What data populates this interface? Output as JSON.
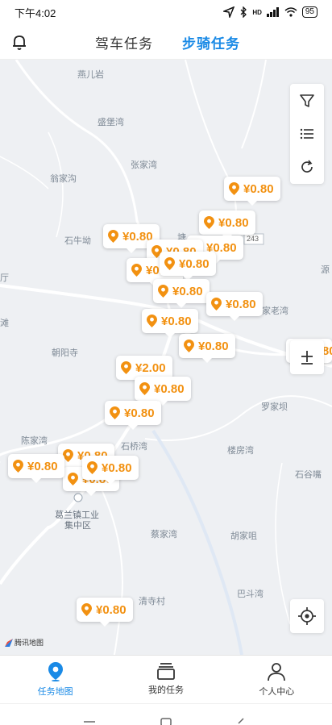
{
  "status_bar": {
    "time": "下午4:02",
    "signal": "HD",
    "battery": "95"
  },
  "header": {
    "tab_driving": "驾车任务",
    "tab_riding": "步骑任务"
  },
  "map": {
    "places": {
      "yaner_yan": "燕儿岩",
      "shengbao_wan": "盛堡湾",
      "zhangjia_wan": "张家湾",
      "wengjia_gou": "翁家沟",
      "shiniu_ao": "石牛坳",
      "zhaoyang_si": "朝阳寺",
      "ting": "厅",
      "tan": "滩",
      "yuan": "源",
      "tu": "塘",
      "jia_lao_wan": "家老湾",
      "luojia_ba": "罗家坝",
      "chenjia_wan": "陈家湾",
      "shiqiao_wan": "石桥湾",
      "loufang_wan": "楼房湾",
      "shigu_ping": "石谷嘴",
      "gelan_industrial": "葛兰镇工业",
      "jizhongqu": "集中区",
      "caijia_wan": "蔡家湾",
      "hujia_ao": "胡家咀",
      "badou_wan": "巴斗湾",
      "qingsi_cun": "清寺村",
      "road_number": "243"
    },
    "markers": [
      {
        "amount": "¥0.80"
      },
      {
        "amount": "¥0.80"
      },
      {
        "amount": "¥0.80"
      },
      {
        "amount": "¥0.80"
      },
      {
        "amount": "¥0.80"
      },
      {
        "amount": "¥0.80"
      },
      {
        "amount": "¥0.80"
      },
      {
        "amount": "¥0.80"
      },
      {
        "amount": "¥0.80"
      },
      {
        "amount": "¥0.80"
      },
      {
        "amount": "¥2.00"
      },
      {
        "amount": "¥0.80"
      },
      {
        "amount": "¥0.80"
      },
      {
        "amount": "¥0.80"
      },
      {
        "amount": "¥0.80"
      },
      {
        "amount": "¥0.80"
      },
      {
        "amount": "¥0.80"
      },
      {
        "amount": "¥0.80"
      },
      {
        "amount": "¥0.80"
      },
      {
        "amount": "¥0.80"
      }
    ],
    "logo_text": "腾讯地图",
    "marker_color": "#f29111"
  },
  "bottom_nav": {
    "task_map": "任务地图",
    "my_tasks": "我的任务",
    "profile": "个人中心"
  },
  "colors": {
    "accent": "#1a8ae6",
    "marker": "#f29111"
  }
}
